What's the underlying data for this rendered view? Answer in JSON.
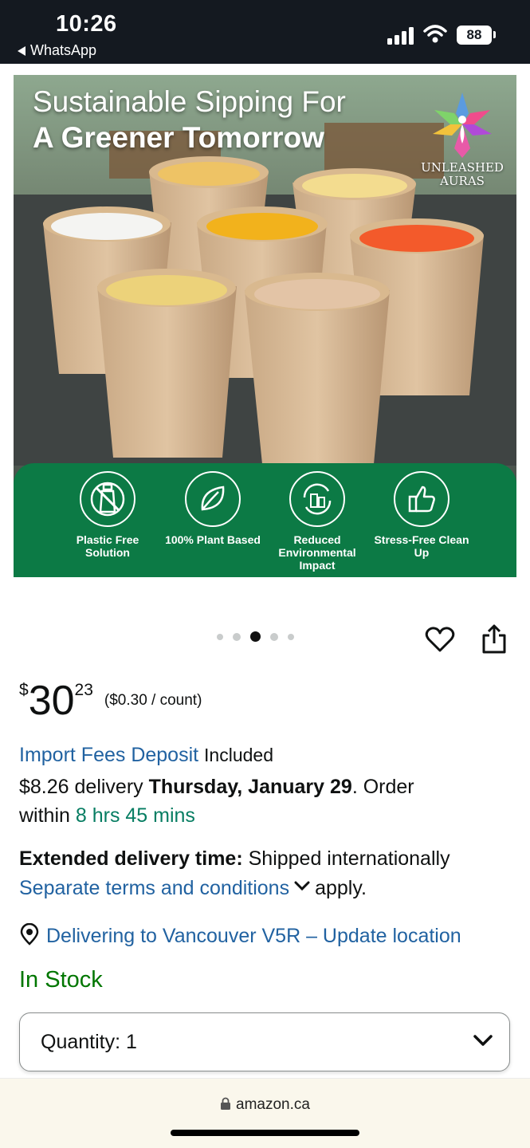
{
  "status_bar": {
    "time": "10:26",
    "back_app": "WhatsApp",
    "battery": "88",
    "icons": [
      "cellular-signal-icon",
      "wifi-icon",
      "battery-icon"
    ]
  },
  "product_image": {
    "headline_line1": "Sustainable Sipping For",
    "headline_line2": "A Greener Tomorrow",
    "brand_line1": "UNLEASHED",
    "brand_line2": "AURAS",
    "features": [
      {
        "label": "Plastic Free Solution",
        "icon": "no-plastic-bottle-icon"
      },
      {
        "label": "100% Plant Based",
        "icon": "leaf-icon"
      },
      {
        "label": "Reduced Environmental Impact",
        "icon": "eco-city-icon"
      },
      {
        "label": "Stress-Free Clean Up",
        "icon": "thumbs-up-icon"
      }
    ],
    "carousel_count": 5,
    "carousel_active_index": 2
  },
  "price": {
    "symbol": "$",
    "whole": "30",
    "fraction": "23",
    "per_unit": "($0.30 / count)"
  },
  "import_fees": {
    "link": "Import Fees Deposit",
    "suffix": "Included"
  },
  "delivery": {
    "prefix": "$8.26 delivery",
    "date": "Thursday, January 29",
    "order_text": ". Order",
    "within": "within",
    "countdown": "8 hrs 45 mins"
  },
  "extended": {
    "bold": "Extended delivery time:",
    "rest": "Shipped internationally",
    "terms_link": "Separate terms and conditions",
    "apply": "apply."
  },
  "location": {
    "text": "Delivering to Vancouver V5R – Update location"
  },
  "stock": "In Stock",
  "quantity": {
    "label": "Quantity:",
    "value": "1"
  },
  "browser": {
    "url": "amazon.ca"
  },
  "colors": {
    "link": "#2162a1",
    "green_time": "#067d62",
    "in_stock": "#007600",
    "feature_band": "#0c7a45",
    "status_bar": "#141920"
  }
}
